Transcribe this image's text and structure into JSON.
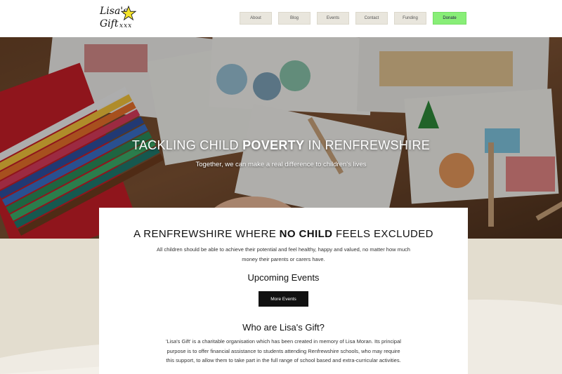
{
  "logo": {
    "line1": "Lisa's",
    "line2": "Gift",
    "xxx": "xxx"
  },
  "nav": {
    "items": [
      {
        "label": "About"
      },
      {
        "label": "Blog"
      },
      {
        "label": "Events"
      },
      {
        "label": "Contact"
      },
      {
        "label": "Funding"
      }
    ],
    "donate_label": "Donate"
  },
  "hero": {
    "title_pre": "TACKLING CHILD ",
    "title_bold": "POVERTY",
    "title_post": " IN RENFREWSHIRE",
    "subtitle": "Together, we can make a real difference to children's lives"
  },
  "card": {
    "heading_pre": "A RENFREWSHIRE WHERE ",
    "heading_bold": "NO CHILD",
    "heading_post": " FEELS EXCLUDED",
    "intro": "All children should be able to achieve their potential and feel healthy, happy and valued, no matter how much money their parents or carers have.",
    "events_title": "Upcoming Events",
    "more_events_label": "More Events",
    "who_title": "Who are Lisa's Gift?",
    "who_text": "'Lisa's Gift' is a charitable organisation which has been created in memory of Lisa Moran. Its principal purpose is to offer financial assistance to students attending Renfrewshire schools, who may require this support, to allow them to take part in the full range of school based and extra-curricular activities."
  },
  "colors": {
    "donate": "#88ee77",
    "nav_bg": "#e9e6dd",
    "page_bg": "#e8e3d6",
    "button_dark": "#111111"
  }
}
